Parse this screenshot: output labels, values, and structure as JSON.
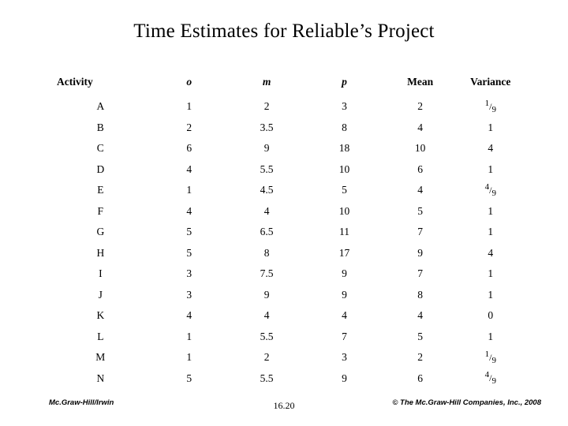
{
  "slide": {
    "title": "Time Estimates for Reliable’s Project",
    "footer_left": "Mc.Graw-Hill/Irwin",
    "footer_center": "16.20",
    "footer_right": "© The Mc.Graw-Hill Companies, Inc., 2008"
  },
  "table": {
    "headers": {
      "activity": "Activity",
      "o": "o",
      "m": "m",
      "p": "p",
      "mean": "Mean",
      "variance": "Variance"
    },
    "rows": [
      {
        "activity": "A",
        "o": "1",
        "m": "2",
        "p": "3",
        "mean": "2",
        "variance": "1/9",
        "gap": false
      },
      {
        "activity": "B",
        "o": "2",
        "m": "3.5",
        "p": "8",
        "mean": "4",
        "variance": "1",
        "gap": false
      },
      {
        "activity": "C",
        "o": "6",
        "m": "9",
        "p": "18",
        "mean": "10",
        "variance": "4",
        "gap": false
      },
      {
        "activity": "D",
        "o": "4",
        "m": "5.5",
        "p": "10",
        "mean": "6",
        "variance": "1",
        "gap": false
      },
      {
        "activity": "E",
        "o": "1",
        "m": "4.5",
        "p": "5",
        "mean": "4",
        "variance": "4/9",
        "gap": false
      },
      {
        "activity": "F",
        "o": "4",
        "m": "4",
        "p": "10",
        "mean": "5",
        "variance": "1",
        "gap": true
      },
      {
        "activity": "G",
        "o": "5",
        "m": "6.5",
        "p": "11",
        "mean": "7",
        "variance": "1",
        "gap": false
      },
      {
        "activity": "H",
        "o": "5",
        "m": "8",
        "p": "17",
        "mean": "9",
        "variance": "4",
        "gap": false
      },
      {
        "activity": "I",
        "o": "3",
        "m": "7.5",
        "p": "9",
        "mean": "7",
        "variance": "1",
        "gap": false
      },
      {
        "activity": "J",
        "o": "3",
        "m": "9",
        "p": "9",
        "mean": "8",
        "variance": "1",
        "gap": false
      },
      {
        "activity": "K",
        "o": "4",
        "m": "4",
        "p": "4",
        "mean": "4",
        "variance": "0",
        "gap": false
      },
      {
        "activity": "L",
        "o": "1",
        "m": "5.5",
        "p": "7",
        "mean": "5",
        "variance": "1",
        "gap": false
      },
      {
        "activity": "M",
        "o": "1",
        "m": "2",
        "p": "3",
        "mean": "2",
        "variance": "1/9",
        "gap": false
      },
      {
        "activity": "N",
        "o": "5",
        "m": "5.5",
        "p": "9",
        "mean": "6",
        "variance": "4/9",
        "gap": false
      }
    ]
  }
}
